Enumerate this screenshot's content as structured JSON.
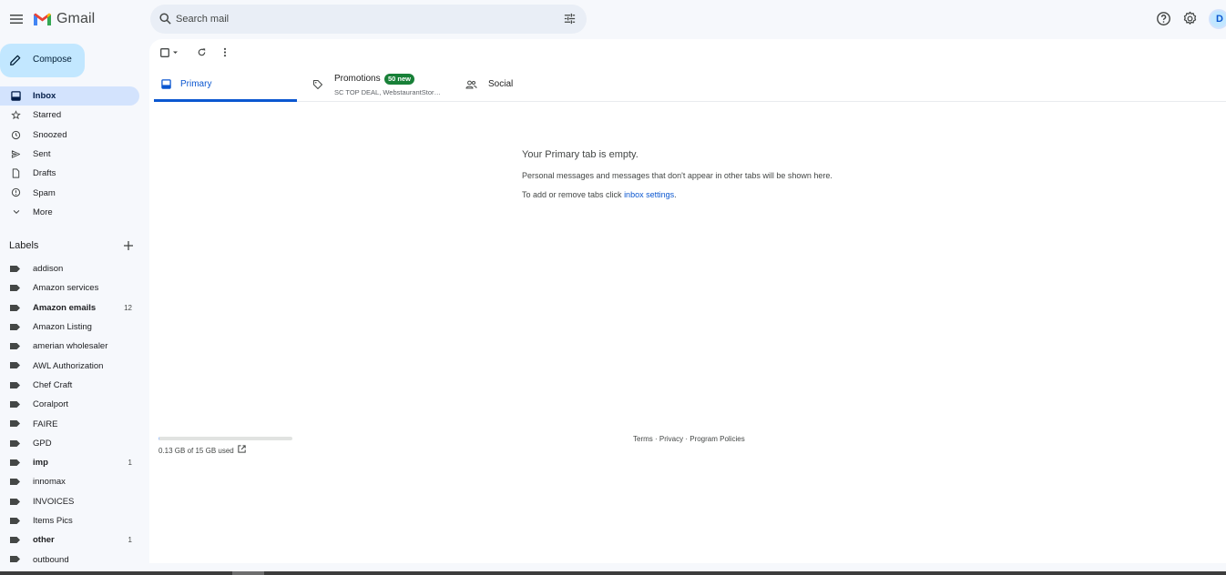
{
  "header": {
    "app_name": "Gmail",
    "search_placeholder": "Search mail",
    "avatar_initials": "D"
  },
  "compose_label": "Compose",
  "nav": [
    {
      "label": "Inbox",
      "icon": "inbox-icon",
      "active": true
    },
    {
      "label": "Starred",
      "icon": "star-icon"
    },
    {
      "label": "Snoozed",
      "icon": "clock-icon"
    },
    {
      "label": "Sent",
      "icon": "send-icon"
    },
    {
      "label": "Drafts",
      "icon": "draft-icon"
    },
    {
      "label": "Spam",
      "icon": "spam-icon"
    },
    {
      "label": "More",
      "icon": "chevron-down-icon"
    }
  ],
  "labels_header": "Labels",
  "labels": [
    {
      "label": "addison",
      "count": ""
    },
    {
      "label": "Amazon services",
      "count": ""
    },
    {
      "label": "Amazon emails",
      "count": "12",
      "bold": true
    },
    {
      "label": "Amazon Listing",
      "count": ""
    },
    {
      "label": "amerian wholesaler",
      "count": ""
    },
    {
      "label": "AWL Authorization",
      "count": ""
    },
    {
      "label": "Chef Craft",
      "count": ""
    },
    {
      "label": "Coralport",
      "count": ""
    },
    {
      "label": "FAIRE",
      "count": ""
    },
    {
      "label": "GPD",
      "count": ""
    },
    {
      "label": "imp",
      "count": "1",
      "bold": true
    },
    {
      "label": "innomax",
      "count": ""
    },
    {
      "label": "INVOICES",
      "count": ""
    },
    {
      "label": "Items Pics",
      "count": ""
    },
    {
      "label": "other",
      "count": "1",
      "bold": true
    },
    {
      "label": "outbound",
      "count": ""
    }
  ],
  "tabs": {
    "primary": "Primary",
    "promotions": "Promotions",
    "promotions_badge": "50 new",
    "promotions_senders": "SC TOP DEAL, WebstaurantStor…",
    "social": "Social"
  },
  "empty_state": {
    "title": "Your Primary tab is empty.",
    "line1": "Personal messages and messages that don't appear in other tabs will be shown here.",
    "line2_prefix": "To add or remove tabs click ",
    "line2_link": "inbox settings",
    "line2_suffix": "."
  },
  "storage": {
    "text": "0.13 GB of 15 GB used",
    "used_fraction": 0.009
  },
  "footer": {
    "terms": "Terms",
    "privacy": "Privacy",
    "policies": "Program Policies",
    "sep": " · "
  },
  "colors": {
    "accent": "#0b57d0",
    "compose_bg": "#c2e7ff",
    "active_nav_bg": "#d3e3fd",
    "badge_green": "#188038"
  }
}
